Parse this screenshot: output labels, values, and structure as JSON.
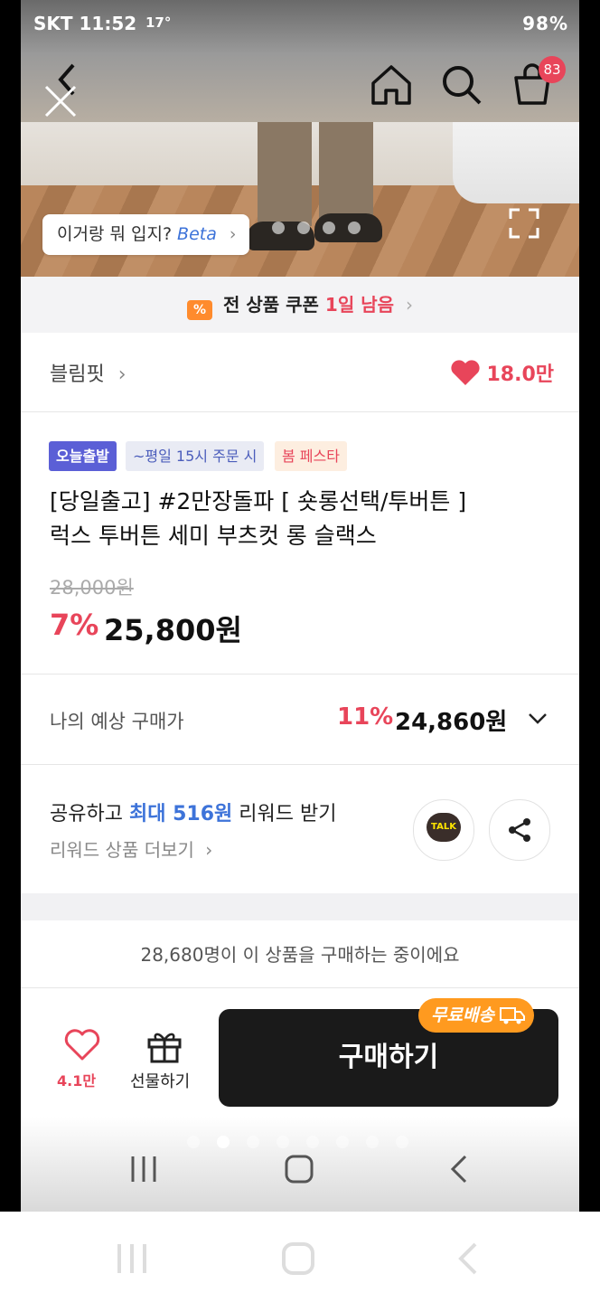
{
  "status_bar": {
    "carrier_time": "SKT 11:52",
    "temp": "17°",
    "battery": "98%"
  },
  "header": {
    "cart_count": "83"
  },
  "image_overlay": {
    "pill_text": "이거랑 뭐 입지?",
    "pill_beta": "Beta"
  },
  "coupon": {
    "text": "전 상품 쿠폰",
    "remaining": "1일 남음"
  },
  "brand": {
    "name": "블림핏",
    "likes": "18.0만"
  },
  "tags": [
    "오늘출발",
    "~평일 15시 주문 시",
    "봄 페스타"
  ],
  "product": {
    "title_line1": "[당일출고] #2만장돌파  [ 숏롱선택/투버튼 ]",
    "title_line2": "럭스 투버튼 세미 부츠컷 롱 슬랙스",
    "original_price": "28,000원",
    "discount": "7%",
    "price": "25,800원"
  },
  "estimate": {
    "label": "나의 예상 구매가",
    "discount": "11%",
    "price": "24,860원"
  },
  "reward": {
    "prefix": "공유하고",
    "highlight": "최대 516원",
    "suffix": "리워드 받기",
    "more": "리워드 상품 더보기"
  },
  "talk_label": "TALK",
  "buyers_text": "28,680명이 이 상품을 구매하는 중이에요",
  "bottom": {
    "wish_count": "4.1만",
    "gift_label": "선물하기",
    "buy_label": "구매하기",
    "free_shipping": "무료배송"
  },
  "colors": {
    "accent_red": "#e8455a",
    "blue": "#3d73d9",
    "buy_bg": "#1a1a1a",
    "free_badge": "#ff9a1f"
  }
}
